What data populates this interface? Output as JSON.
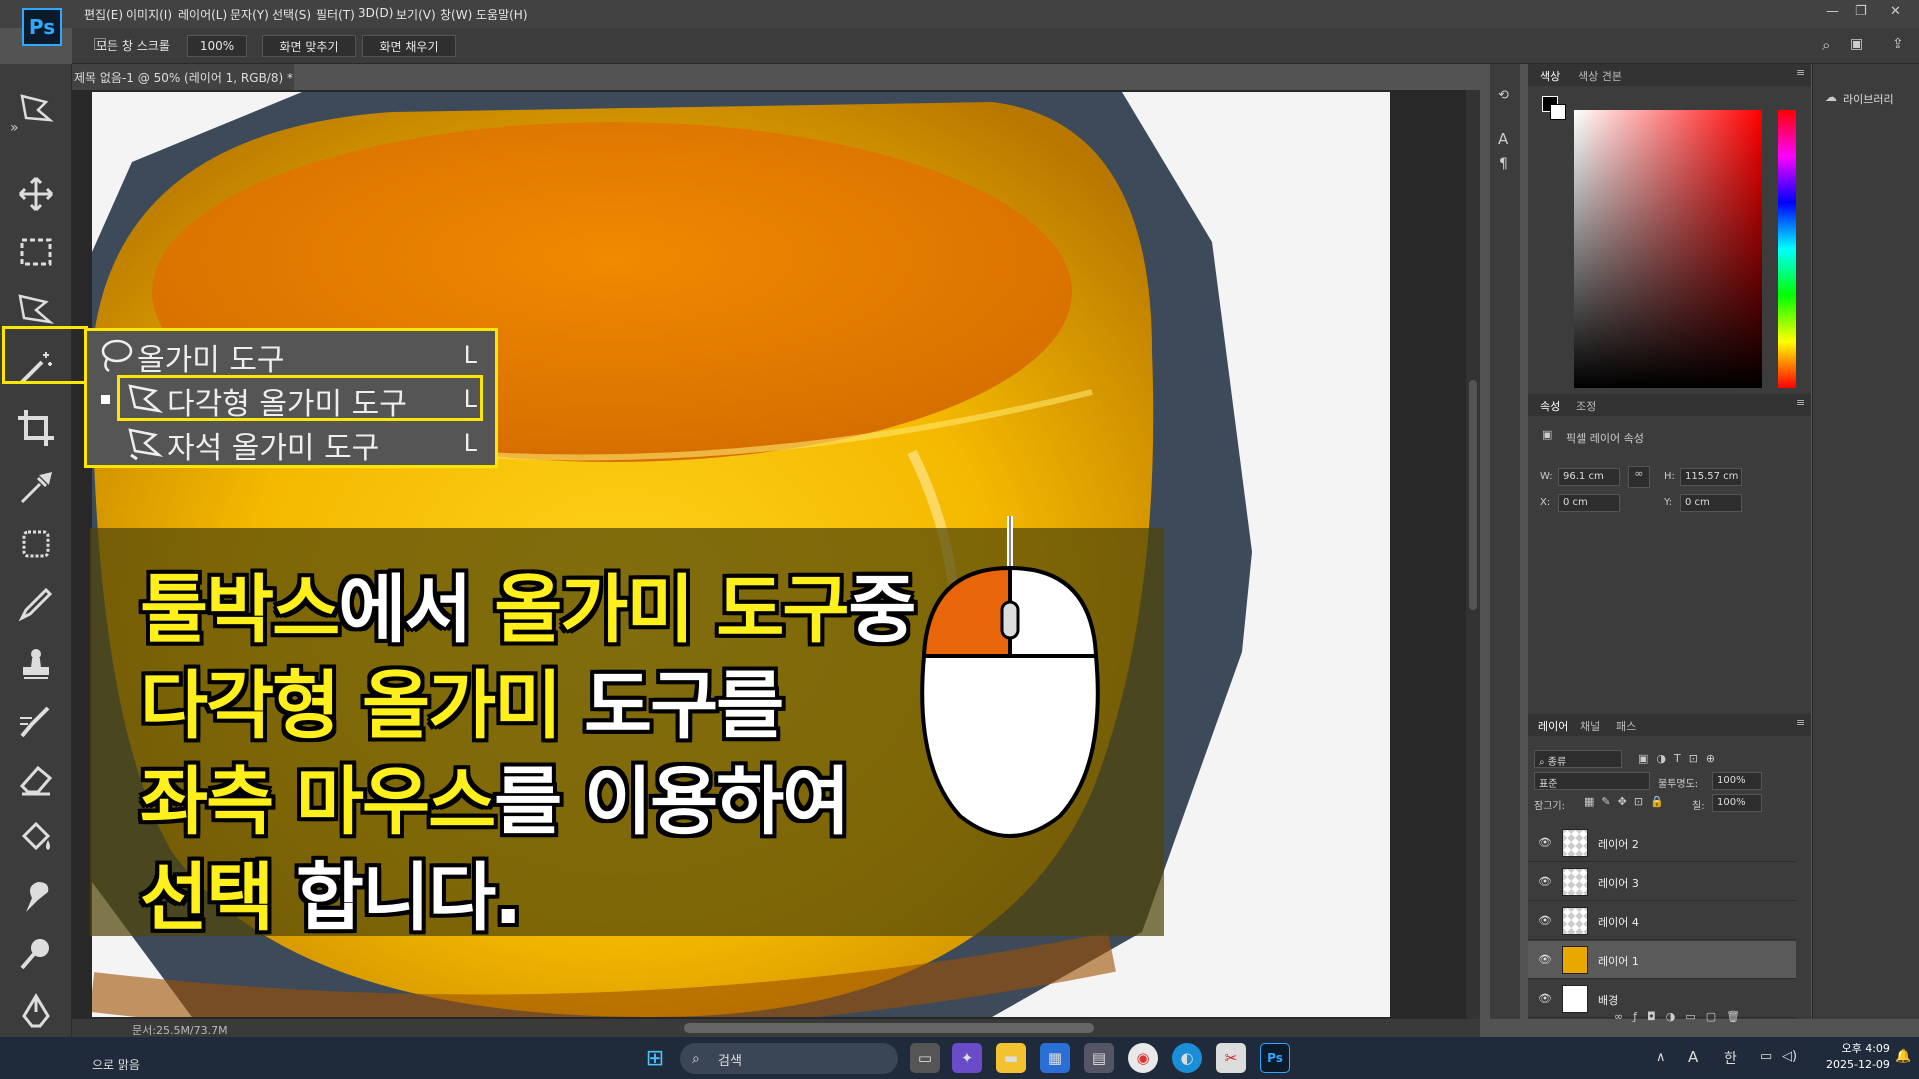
{
  "app": {
    "logo": "Ps"
  },
  "menu": [
    "편집(E)",
    "이미지(I)",
    "레이어(L)",
    "문자(Y)",
    "선택(S)",
    "필터(T)",
    "3D(D)",
    "보기(V)",
    "창(W)",
    "도움말(H)"
  ],
  "options_bar": {
    "scroll_all": "모든 창 스크롤",
    "zoom": "100%",
    "fit_screen": "화면 맞추기",
    "fill_screen": "화면 채우기"
  },
  "document": {
    "tab_title": "제목 없음-1 @ 50% (레이어 1, RGB/8) *",
    "tab_close": "×",
    "doc_size": "문서:25.5M/73.7M"
  },
  "lasso_flyout": {
    "items": [
      {
        "label": "올가미 도구",
        "key": "L",
        "icon": "lasso-icon"
      },
      {
        "label": "다각형 올가미 도구",
        "key": "L",
        "icon": "polygonal-lasso-icon",
        "selected": true
      },
      {
        "label": "자석 올가미 도구",
        "key": "L",
        "icon": "magnetic-lasso-icon"
      }
    ]
  },
  "caption": {
    "line1": {
      "a": "툴박스",
      "b": "에서 ",
      "c": "올가미 도구",
      "d": "중"
    },
    "line2": {
      "a": "다각형 올가미",
      "b": " 도구를"
    },
    "line3": {
      "a": "좌측 마우스",
      "b": "를 이용하여"
    },
    "line4": {
      "a": "선택",
      "b": " 합니다."
    }
  },
  "color_panel": {
    "tabs": [
      "색상",
      "색상 견본"
    ]
  },
  "properties_panel": {
    "tabs": [
      "속성",
      "조정"
    ],
    "title": "픽셀 레이어 속성",
    "w_label": "W:",
    "w_value": "96.1 cm",
    "h_label": "H:",
    "h_value": "115.57 cm",
    "x_label": "X:",
    "x_value": "0 cm",
    "y_label": "Y:",
    "y_value": "0 cm"
  },
  "layers_panel": {
    "tabs": [
      "레이어",
      "채널",
      "패스"
    ],
    "filter": "종류",
    "blend_mode": "표준",
    "opacity_label": "불투명도:",
    "opacity": "100%",
    "lock_label": "잠그기:",
    "fill_label": "칠:",
    "fill": "100%",
    "layers": [
      {
        "name": "레이어 2"
      },
      {
        "name": "레이어 3"
      },
      {
        "name": "레이어 4"
      },
      {
        "name": "레이어 1",
        "selected": true
      },
      {
        "name": "배경"
      }
    ]
  },
  "libraries_panel": {
    "label": "라이브러리"
  },
  "taskbar": {
    "search": "검색",
    "status_left": "으로 맑음",
    "time": "오후 4:09",
    "date": "2025-12-09",
    "ime_a": "A",
    "ime_han": "한"
  },
  "colors": {
    "accent_yellow": "#ffe600",
    "ps_blue": "#31a8ff",
    "mouse_orange": "#e8650a"
  }
}
